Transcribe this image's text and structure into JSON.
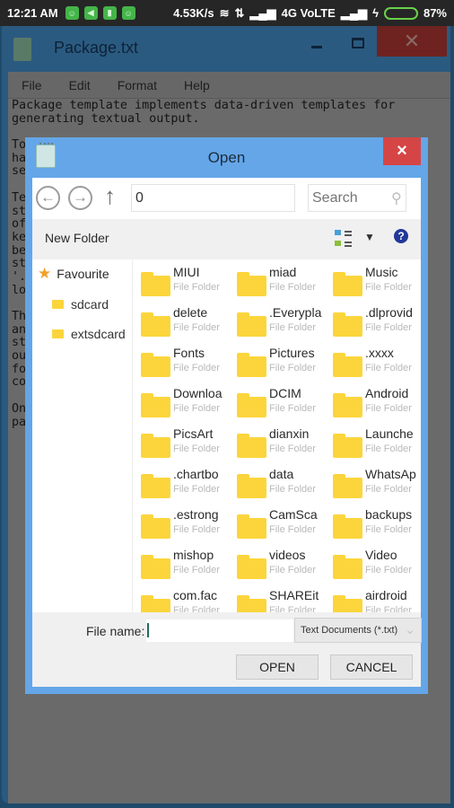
{
  "status_bar": {
    "time": "12:21 AM",
    "app_icons": [
      "android-icon",
      "send-icon",
      "clipboard-icon",
      "android-icon"
    ],
    "net_speed": "4.53K/s",
    "network": "4G VoLTE",
    "battery_percent": "87%",
    "battery_level": 0.87
  },
  "app": {
    "title": "Package.txt",
    "menu": [
      "File",
      "Edit",
      "Format",
      "Help"
    ],
    "text_lines": [
      "Package template implements data-driven templates for",
      "generating textual output.",
      "",
      "To                                                  ch",
      "ha                                                  y",
      "se",
      "",
      "Te",
      "st                                                  s",
      "of                                                   a",
      "ke",
      "be",
      "st",
      "'.",
      "lo",
      "",
      "Th",
      "an",
      "st",
      "ou                                                  ot",
      "fo                                                  n",
      "co",
      "",
      "On",
      "pa"
    ]
  },
  "dialog": {
    "title": "Open",
    "close": "×",
    "path_value": "0",
    "search_placeholder": "Search",
    "new_folder": "New Folder",
    "sidebar": {
      "favourite": "Favourite",
      "drives": [
        "sdcard",
        "extsdcard"
      ]
    },
    "folders": [
      {
        "name": "MIUI",
        "type": "File Folder"
      },
      {
        "name": "miad",
        "type": "File Folder"
      },
      {
        "name": "Music",
        "type": "File Folder"
      },
      {
        "name": "delete",
        "type": "File Folder"
      },
      {
        "name": ".Everypla",
        "type": "File Folder"
      },
      {
        "name": ".dlprovid",
        "type": "File Folder"
      },
      {
        "name": "Fonts",
        "type": "File Folder"
      },
      {
        "name": "Pictures",
        "type": "File Folder"
      },
      {
        "name": ".xxxx",
        "type": "File Folder"
      },
      {
        "name": "Downloa",
        "type": "File Folder"
      },
      {
        "name": "DCIM",
        "type": "File Folder"
      },
      {
        "name": "Android",
        "type": "File Folder"
      },
      {
        "name": "PicsArt",
        "type": "File Folder"
      },
      {
        "name": "dianxin",
        "type": "File Folder"
      },
      {
        "name": "Launche",
        "type": "File Folder"
      },
      {
        "name": ".chartbo",
        "type": "File Folder"
      },
      {
        "name": "data",
        "type": "File Folder"
      },
      {
        "name": "WhatsAp",
        "type": "File Folder"
      },
      {
        "name": ".estrong",
        "type": "File Folder"
      },
      {
        "name": "CamSca",
        "type": "File Folder"
      },
      {
        "name": "backups",
        "type": "File Folder"
      },
      {
        "name": "mishop",
        "type": "File Folder"
      },
      {
        "name": "videos",
        "type": "File Folder"
      },
      {
        "name": "Video",
        "type": "File Folder"
      },
      {
        "name": "com.fac",
        "type": "File Folder"
      },
      {
        "name": "SHAREit",
        "type": "File Folder"
      },
      {
        "name": "airdroid",
        "type": "File Folder"
      }
    ],
    "file_name_label": "File name:",
    "file_name_value": "",
    "filter": "Text Documents (*.txt)",
    "open_button": "OPEN",
    "cancel_button": "CANCEL"
  },
  "colors": {
    "dialog_frame": "#64a6e8",
    "close_red": "#d64545",
    "folder_yellow": "#fcd53c",
    "help_blue": "#22389a"
  }
}
